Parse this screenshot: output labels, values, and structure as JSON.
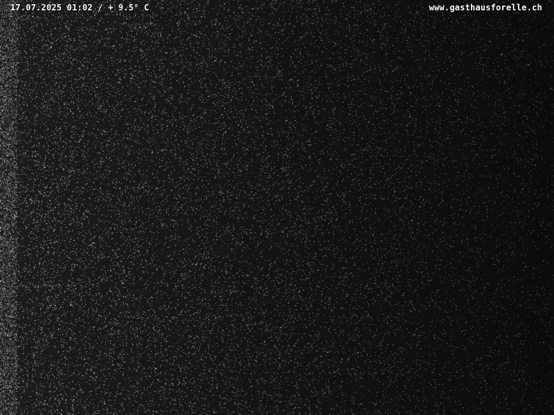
{
  "webcam": {
    "timestamp_temperature": "17.07.2025 01:02 / + 9.5° C",
    "website": "www.gasthausforelle.ch"
  },
  "colors": {
    "background": "#0b0b0b",
    "overlay_text": "#ffffff"
  }
}
